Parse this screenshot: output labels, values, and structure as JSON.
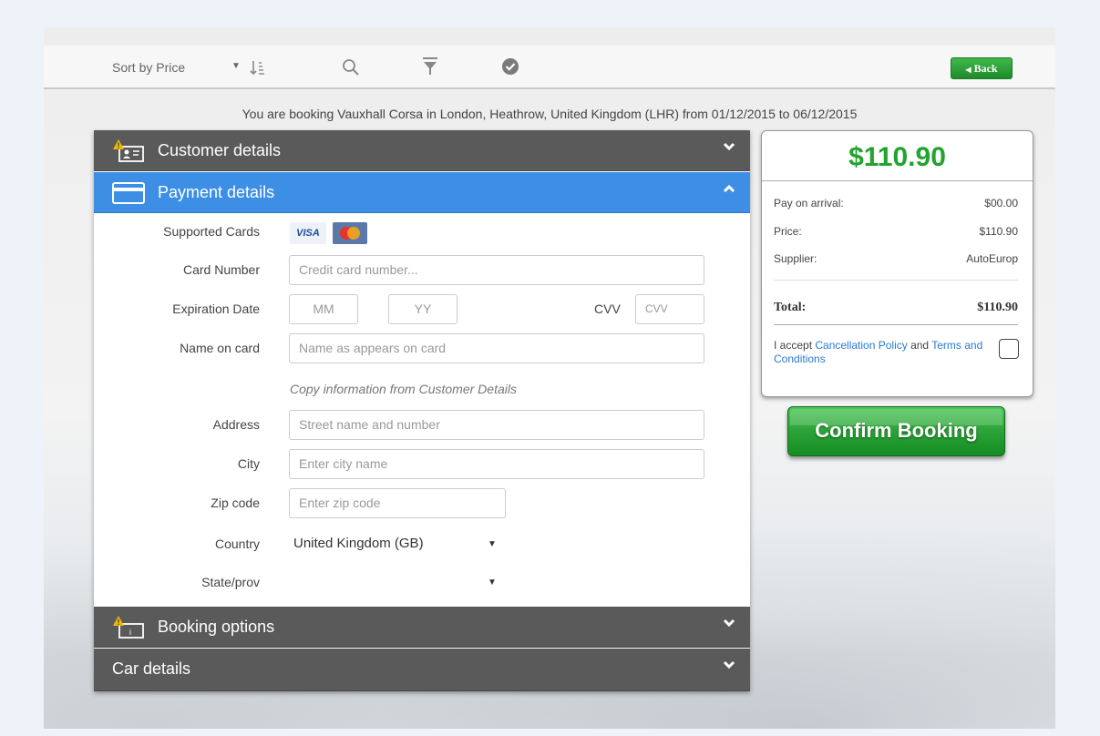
{
  "topbar": {
    "sort_label": "Sort by Price",
    "sort_caret": "▼",
    "icons": [
      "sort-icon",
      "search-icon",
      "filter-icon",
      "check-circle-icon"
    ],
    "back_label": "Back",
    "back_glyph": "◀"
  },
  "booking_message": "You are booking Vauxhall Corsa in London, Heathrow, United Kingdom (LHR) from 01/12/2015 to 06/12/2015",
  "accordion": {
    "customer": {
      "title": "Customer details",
      "icon": "id-card-warning-icon",
      "state": "collapsed"
    },
    "payment": {
      "title": "Payment details",
      "icon": "credit-card-icon",
      "state": "expanded"
    },
    "booking": {
      "title": "Booking options",
      "icon": "info-card-warning-icon",
      "state": "collapsed"
    },
    "car": {
      "title": "Car details",
      "state": "collapsed"
    }
  },
  "payment_form": {
    "supported_cards_label": "Supported Cards",
    "visa_text": "VISA",
    "card_number_label": "Card Number",
    "card_number_placeholder": "Credit card number...",
    "expiration_label": "Expiration Date",
    "mm_placeholder": "MM",
    "yy_placeholder": "YY",
    "cvv_label": "CVV",
    "cvv_placeholder": "CVV",
    "name_label": "Name on card",
    "name_placeholder": "Name as appears on card",
    "copy_info": "Copy information from Customer Details",
    "address_label": "Address",
    "address_placeholder": "Street name and number",
    "city_label": "City",
    "city_placeholder": "Enter city name",
    "zip_label": "Zip code",
    "zip_placeholder": "Enter zip code",
    "country_label": "Country",
    "country_value": "United Kingdom (GB)",
    "state_label": "State/prov",
    "state_value": "",
    "caret": "▼"
  },
  "summary": {
    "total_big": "$110.90",
    "pay_on_arrival_label": "Pay on arrival:",
    "pay_on_arrival_value": "$00.00",
    "price_label": "Price:",
    "price_value": "$110.90",
    "supplier_label": "Supplier:",
    "supplier_value": "AutoEurop",
    "total_label": "Total:",
    "total_value": "$110.90",
    "accept_prefix": "I accept ",
    "cancellation_link": "Cancellation Policy",
    "accept_and": " and ",
    "terms_link": "Terms and Conditions",
    "accepted": false
  },
  "confirm_label": "Confirm Booking",
  "colors": {
    "accent_blue": "#3d8fe6",
    "accordion_gray": "#5a5a5a",
    "price_green": "#23a32f",
    "warning_yellow": "#f5b800"
  }
}
